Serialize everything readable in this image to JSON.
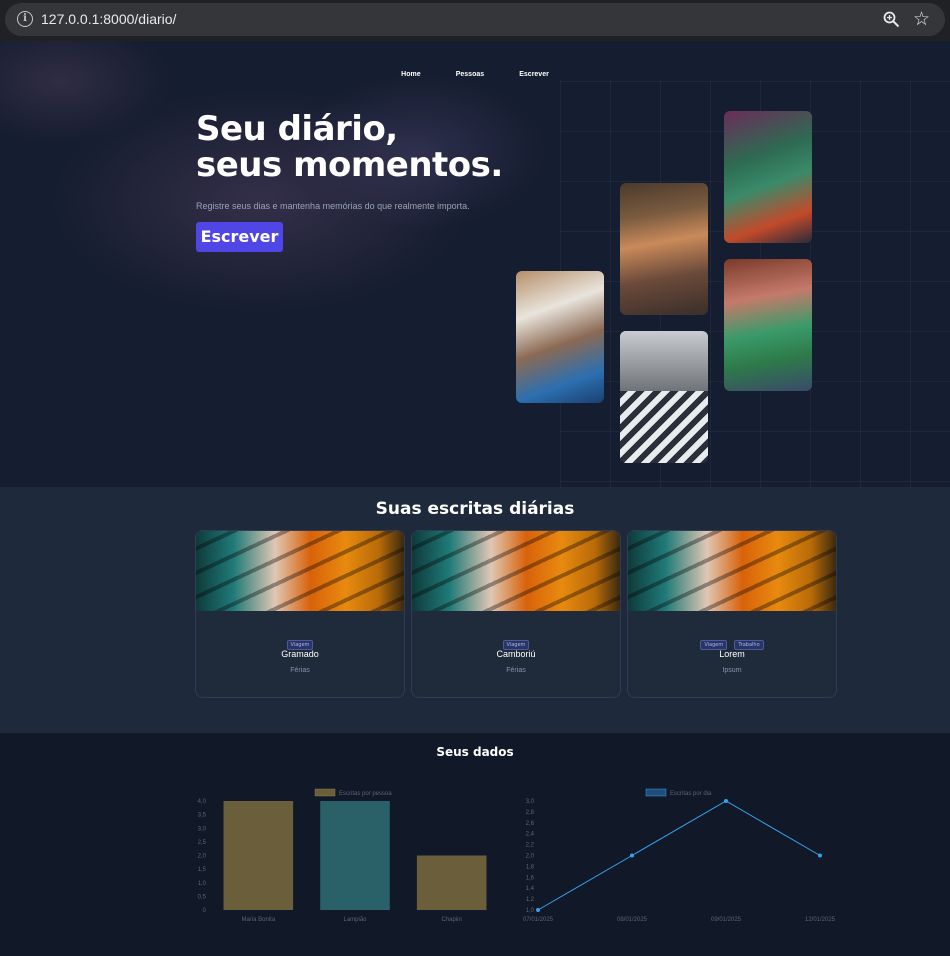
{
  "browser": {
    "url": "127.0.0.1:8000/diario/"
  },
  "nav": {
    "items": [
      "Home",
      "Pessoas",
      "Escrever"
    ]
  },
  "hero": {
    "title_line1": "Seu diário,",
    "title_line2": "seus momentos.",
    "subtitle": "Registre seus dias e mantenha memórias do que realmente importa.",
    "cta_label": "Escrever"
  },
  "posts": {
    "title": "Suas escritas diárias",
    "cards": [
      {
        "tags": [
          "Viagem"
        ],
        "title": "Gramado",
        "subtitle": "Férias"
      },
      {
        "tags": [
          "Viagem"
        ],
        "title": "Camboriú",
        "subtitle": "Férias"
      },
      {
        "tags": [
          "Viagem",
          "Trabalho"
        ],
        "title": "Lorem",
        "subtitle": "Ipsum"
      }
    ]
  },
  "data_section": {
    "title": "Seus dados"
  },
  "colors": {
    "accent": "#4f46e5",
    "bar_a": "#6b5f3b",
    "bar_b": "#2a6068",
    "line": "#36a2eb"
  },
  "chart_data": [
    {
      "type": "bar",
      "legend": "Escritas por pessoa",
      "categories": [
        "Maria Bonita",
        "Lampião",
        "Chapiin"
      ],
      "values": [
        4,
        4,
        2
      ],
      "ylim": [
        0,
        4
      ],
      "yticks": [
        "0",
        "0,5",
        "1,0",
        "1,5",
        "2,0",
        "2,5",
        "3,0",
        "3,5",
        "4,0"
      ]
    },
    {
      "type": "line",
      "legend": "Escritas por dia",
      "categories": [
        "07/01/2025",
        "08/01/2025",
        "09/01/2025",
        "12/01/2025"
      ],
      "values": [
        1,
        2,
        3,
        2
      ],
      "ylim": [
        1,
        3
      ],
      "yticks": [
        "1,0",
        "1,2",
        "1,4",
        "1,6",
        "1,8",
        "2,0",
        "2,2",
        "2,4",
        "2,6",
        "2,8",
        "3,0"
      ]
    }
  ]
}
